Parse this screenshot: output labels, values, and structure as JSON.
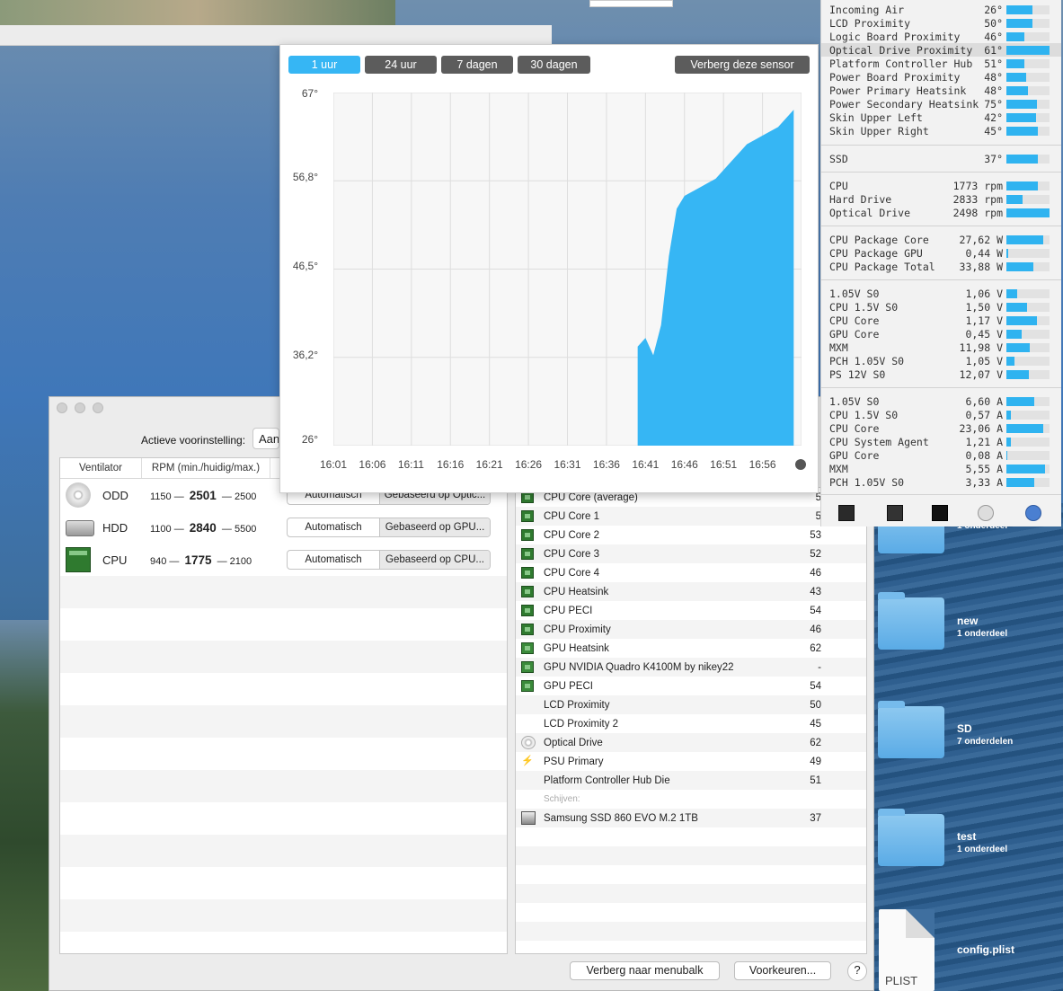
{
  "chart": {
    "tabs": [
      "1 uur",
      "24 uur",
      "7 dagen",
      "30 dagen"
    ],
    "hide_sensor_label": "Verberg deze sensor",
    "y_ticks": [
      "67°",
      "56,8°",
      "46,5°",
      "36,2°",
      "26°"
    ],
    "x_ticks": [
      "16:01",
      "16:06",
      "16:11",
      "16:16",
      "16:21",
      "16:26",
      "16:31",
      "16:36",
      "16:41",
      "16:46",
      "16:51",
      "16:56"
    ]
  },
  "chart_data": {
    "type": "area",
    "x": [
      "16:40",
      "16:41",
      "16:42",
      "16:43",
      "16:44",
      "16:45",
      "16:46",
      "16:47",
      "16:48",
      "16:49",
      "16:50",
      "16:51",
      "16:52",
      "16:53",
      "16:54",
      "16:55",
      "16:56",
      "16:57",
      "16:58",
      "16:59",
      "17:00"
    ],
    "series": [
      {
        "values": [
          37.5,
          38.5,
          36.5,
          40,
          48,
          53.5,
          55,
          55.5,
          56,
          56.5,
          57,
          58,
          59,
          60,
          61,
          61.5,
          62,
          62.5,
          63,
          64,
          65
        ]
      }
    ],
    "xlabel": "",
    "ylabel": "",
    "ylim": [
      26,
      67
    ],
    "grid": true,
    "color": "#36b6f4"
  },
  "main_window": {
    "preset_label": "Actieve voorinstelling:",
    "preset_value": "Aan",
    "fan_headers": [
      "Ventilator",
      "RPM (min./huidig/max.)"
    ],
    "fans": [
      {
        "name": "ODD",
        "min": "1150",
        "cur": "2501",
        "max": "2500",
        "mode": "Automatisch",
        "basis": "Gebaseerd op Optic...",
        "icon": "optical-disc-icon"
      },
      {
        "name": "HDD",
        "min": "1100",
        "cur": "2840",
        "max": "5500",
        "mode": "Automatisch",
        "basis": "Gebaseerd op GPU...",
        "icon": "hard-drive-icon"
      },
      {
        "name": "CPU",
        "min": "940",
        "cur": "1775",
        "max": "2100",
        "mode": "Automatisch",
        "basis": "Gebaseerd op CPU...",
        "icon": "cpu-chip-icon"
      }
    ],
    "sensors": [
      {
        "name": "CPU Core (average)",
        "value": "5",
        "icon": "chip"
      },
      {
        "name": "CPU Core 1",
        "value": "5",
        "icon": "chip"
      },
      {
        "name": "CPU Core 2",
        "value": "53",
        "icon": "chip"
      },
      {
        "name": "CPU Core 3",
        "value": "52",
        "icon": "chip"
      },
      {
        "name": "CPU Core 4",
        "value": "46",
        "icon": "chip"
      },
      {
        "name": "CPU Heatsink",
        "value": "43",
        "icon": "chip"
      },
      {
        "name": "CPU PECI",
        "value": "54",
        "icon": "chip"
      },
      {
        "name": "CPU Proximity",
        "value": "46",
        "icon": "chip"
      },
      {
        "name": "GPU Heatsink",
        "value": "62",
        "icon": "gpu"
      },
      {
        "name": "GPU NVIDIA Quadro K4100M by nikey22",
        "value": "-",
        "icon": "gpu"
      },
      {
        "name": "GPU PECI",
        "value": "54",
        "icon": "gpu"
      },
      {
        "name": "LCD Proximity",
        "value": "50",
        "icon": ""
      },
      {
        "name": "LCD Proximity 2",
        "value": "45",
        "icon": ""
      },
      {
        "name": "Optical Drive",
        "value": "62",
        "icon": "disc"
      },
      {
        "name": "PSU Primary",
        "value": "49",
        "icon": "bolt"
      },
      {
        "name": "Platform Controller Hub Die",
        "value": "51",
        "icon": ""
      },
      {
        "name": "Schijven:",
        "value": "",
        "icon": "section"
      },
      {
        "name": "Samsung SSD 860 EVO M.2 1TB",
        "value": "37",
        "icon": "ssd"
      }
    ],
    "hide_menubar_label": "Verberg naar menubalk",
    "preferences_label": "Voorkeuren...",
    "help_label": "?"
  },
  "side_panel": {
    "temps": [
      {
        "name": "Incoming Air",
        "value": "26°",
        "fill": 0.6
      },
      {
        "name": "LCD Proximity",
        "value": "50°",
        "fill": 0.6
      },
      {
        "name": "Logic Board Proximity",
        "value": "46°",
        "fill": 0.42
      },
      {
        "name": "Optical Drive Proximity",
        "value": "61°",
        "fill": 1.0,
        "highlight": true
      },
      {
        "name": "Platform Controller Hub",
        "value": "51°",
        "fill": 0.42
      },
      {
        "name": "Power Board Proximity",
        "value": "48°",
        "fill": 0.45
      },
      {
        "name": "Power Primary Heatsink",
        "value": "48°",
        "fill": 0.5
      },
      {
        "name": "Power Secondary Heatsink",
        "value": "75°",
        "fill": 0.7
      },
      {
        "name": "Skin Upper Left",
        "value": "42°",
        "fill": 0.68
      },
      {
        "name": "Skin Upper Right",
        "value": "45°",
        "fill": 0.72
      }
    ],
    "ssd": [
      {
        "name": "SSD",
        "value": "37°",
        "fill": 0.72
      }
    ],
    "fans": [
      {
        "name": "CPU",
        "value": "1773 rpm",
        "fill": 0.72
      },
      {
        "name": "Hard Drive",
        "value": "2833 rpm",
        "fill": 0.38
      },
      {
        "name": "Optical Drive",
        "value": "2498 rpm",
        "fill": 1.0
      }
    ],
    "power": [
      {
        "name": "CPU Package Core",
        "value": "27,62 W",
        "fill": 0.85
      },
      {
        "name": "CPU Package GPU",
        "value": "0,44 W",
        "fill": 0.04
      },
      {
        "name": "CPU Package Total",
        "value": "33,88 W",
        "fill": 0.62
      }
    ],
    "voltage": [
      {
        "name": "1.05V S0",
        "value": "1,06 V",
        "fill": 0.25
      },
      {
        "name": "CPU 1.5V S0",
        "value": "1,50 V",
        "fill": 0.48
      },
      {
        "name": "CPU Core",
        "value": "1,17 V",
        "fill": 0.7
      },
      {
        "name": "GPU Core",
        "value": "0,45 V",
        "fill": 0.35
      },
      {
        "name": "MXM",
        "value": "11,98 V",
        "fill": 0.55
      },
      {
        "name": "PCH 1.05V S0",
        "value": "1,05 V",
        "fill": 0.18
      },
      {
        "name": "PS 12V S0",
        "value": "12,07 V",
        "fill": 0.52
      }
    ],
    "current": [
      {
        "name": "1.05V S0",
        "value": "6,60 A",
        "fill": 0.65
      },
      {
        "name": "CPU 1.5V S0",
        "value": "0,57 A",
        "fill": 0.1
      },
      {
        "name": "CPU Core",
        "value": "23,06 A",
        "fill": 0.85
      },
      {
        "name": "CPU System Agent",
        "value": "1,21 A",
        "fill": 0.1
      },
      {
        "name": "GPU Core",
        "value": "0,08 A",
        "fill": 0.03
      },
      {
        "name": "MXM",
        "value": "5,55 A",
        "fill": 0.9
      },
      {
        "name": "PCH 1.05V S0",
        "value": "3,33 A",
        "fill": 0.65
      }
    ],
    "toolbar_icons": [
      "activity-monitor-icon",
      "console-icon",
      "terminal-icon",
      "disk-utility-icon",
      "system-info-icon"
    ],
    "folder_partial_count": "1 onderdeel"
  },
  "desktop": {
    "folders": [
      {
        "name": "new",
        "count": "1 onderdeel"
      },
      {
        "name": "SD",
        "count": "7 onderdelen"
      },
      {
        "name": "test",
        "count": "1 onderdeel"
      }
    ],
    "file_name": "config.plist",
    "file_badge": "PLIST"
  }
}
